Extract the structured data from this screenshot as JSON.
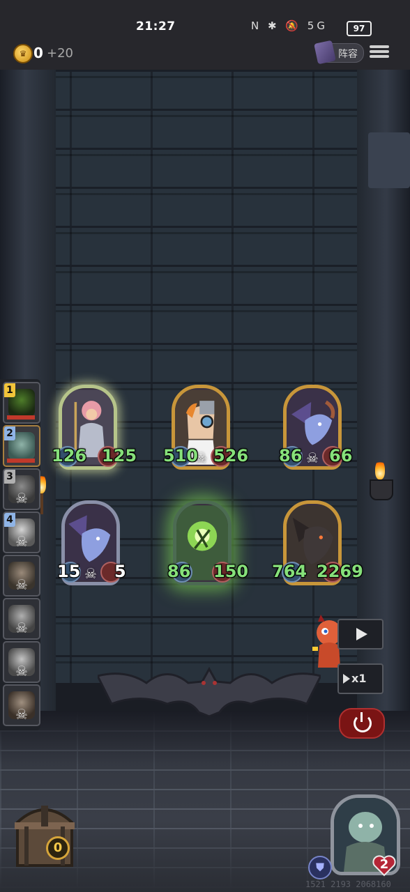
{
  "status_bar": {
    "time": "21:27",
    "system_icons": "N ✱ 🔕 5G",
    "battery": "97"
  },
  "hud": {
    "gold": "0",
    "gold_income": "+20",
    "lineup_label": "阵容"
  },
  "queue": {
    "slots": [
      {
        "num": "1",
        "type": "hero",
        "active": false
      },
      {
        "num": "2",
        "type": "hero",
        "active": true
      },
      {
        "num": "3",
        "type": "enemy"
      },
      {
        "num": "4",
        "type": "enemy"
      },
      {
        "num": "",
        "type": "enemy"
      },
      {
        "num": "",
        "type": "enemy"
      },
      {
        "num": "",
        "type": "enemy"
      },
      {
        "num": "",
        "type": "enemy"
      }
    ]
  },
  "units": {
    "knight": {
      "atk": "126",
      "hp": "125"
    },
    "doctor": {
      "atk": "510",
      "hp": "526"
    },
    "dragon_small": {
      "atk": "86",
      "hp": "66"
    },
    "dragon_blue": {
      "atk": "15",
      "hp": "5"
    },
    "spirit": {
      "atk": "86",
      "hp": "150"
    },
    "dragon_black": {
      "atk": "764",
      "hp": "2269"
    }
  },
  "controls": {
    "speed_label": "x1"
  },
  "bottom": {
    "chest_count": "0",
    "hero_hp": "2"
  },
  "watermark": "1521 2193 2068160",
  "colors": {
    "stat_green": "#86e07a",
    "stat_damaged": "#ff5d4f",
    "frame_gold": "#c8963a",
    "frame_silver": "#8a90a8"
  }
}
